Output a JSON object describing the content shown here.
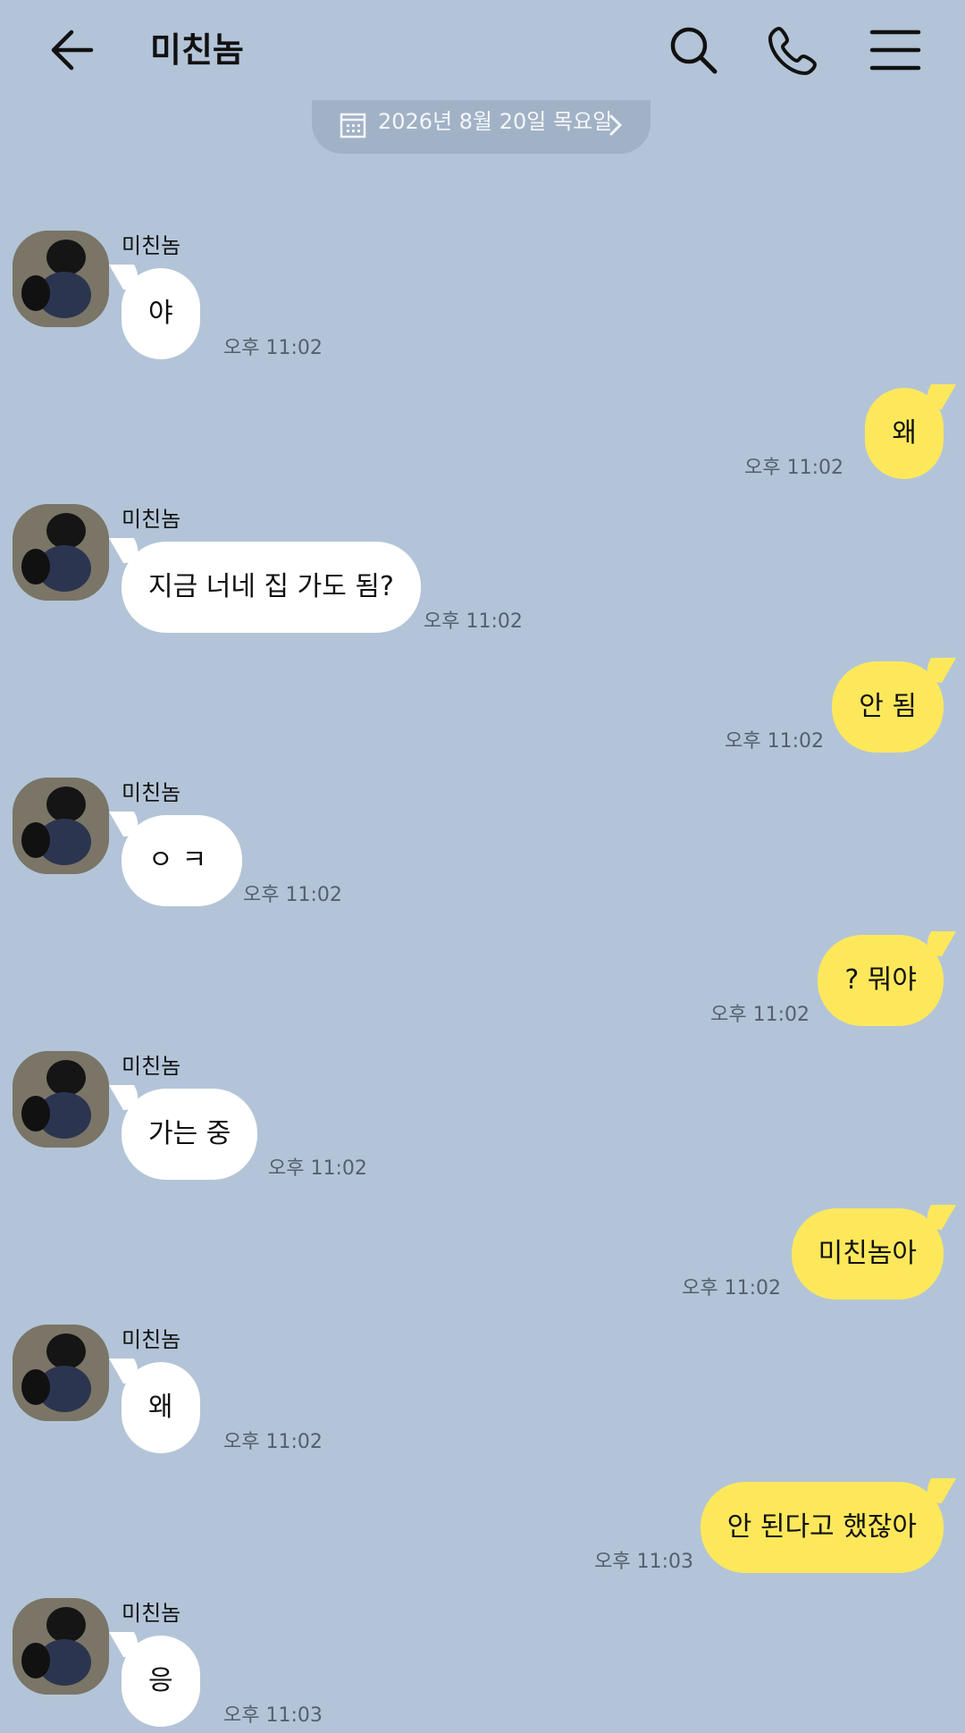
{
  "header": {
    "title": "미친놈",
    "back_icon": "arrow-left-icon",
    "search_icon": "search-icon",
    "call_icon": "phone-icon",
    "menu_icon": "menu-icon"
  },
  "date_divider": {
    "text": "2026년 8월 20일 목요일",
    "icon": "calendar-icon"
  },
  "colors": {
    "background": "#b3c4d8",
    "incoming_bubble": "#ffffff",
    "outgoing_bubble": "#fde85c"
  },
  "messages": [
    {
      "side": "in",
      "sender": "미친놈",
      "text": "야",
      "time": "오후 11:02"
    },
    {
      "side": "out",
      "text": "왜",
      "time": "오후 11:02"
    },
    {
      "side": "in",
      "sender": "미친놈",
      "text": "지금 너네 집 가도 됨?",
      "time": "오후 11:02"
    },
    {
      "side": "out",
      "text": "안 됨",
      "time": "오후 11:02"
    },
    {
      "side": "in",
      "sender": "미친놈",
      "text": "ㅇㅋ",
      "time": "오후 11:02"
    },
    {
      "side": "out",
      "text": "? 뭐야",
      "time": "오후 11:02"
    },
    {
      "side": "in",
      "sender": "미친놈",
      "text": "가는 중",
      "time": "오후 11:02"
    },
    {
      "side": "out",
      "text": "미친놈아",
      "time": "오후 11:02"
    },
    {
      "side": "in",
      "sender": "미친놈",
      "text": "왜",
      "time": "오후 11:02"
    },
    {
      "side": "out",
      "text": "안 된다고 했잖아",
      "time": "오후 11:03"
    },
    {
      "side": "in",
      "sender": "미친놈",
      "text": "응",
      "time": "오후 11:03"
    }
  ]
}
